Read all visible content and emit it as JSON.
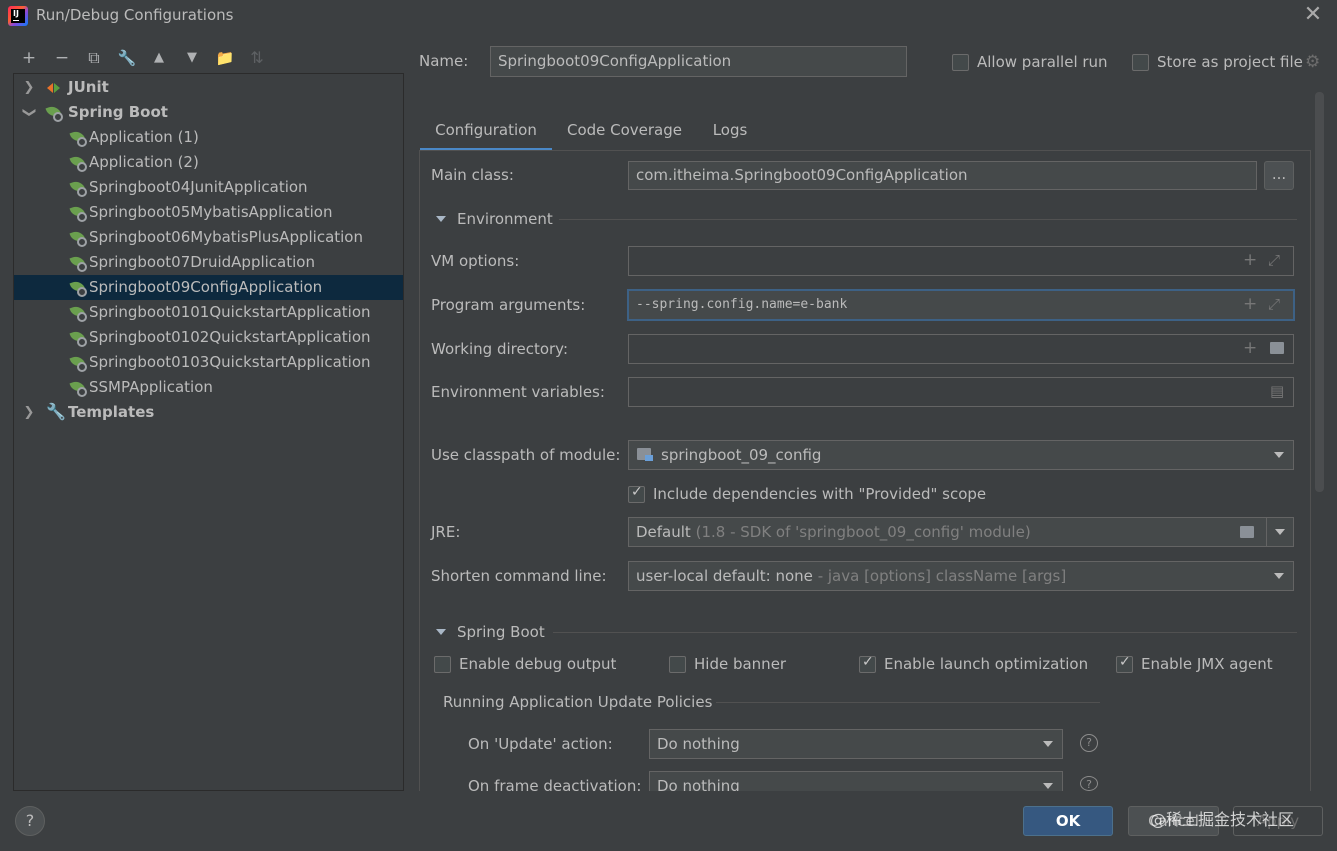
{
  "window": {
    "title": "Run/Debug Configurations"
  },
  "toolbar": {
    "buttons": [
      {
        "icon": "plus-icon",
        "glyph": "+"
      },
      {
        "icon": "minus-icon",
        "glyph": "−"
      },
      {
        "icon": "copy-icon",
        "glyph": "⧉"
      },
      {
        "icon": "wrench-icon",
        "glyph": "🔧"
      },
      {
        "icon": "arrow-up-icon",
        "glyph": "▲"
      },
      {
        "icon": "arrow-down-icon",
        "glyph": "▼"
      },
      {
        "icon": "folder-add-icon",
        "glyph": "📁"
      },
      {
        "icon": "sort-icon",
        "glyph": "⇅"
      }
    ]
  },
  "tree": {
    "junit": "JUnit",
    "spring_boot": "Spring Boot",
    "items": [
      "Application (1)",
      "Application (2)",
      "Springboot04JunitApplication",
      "Springboot05MybatisApplication",
      "Springboot06MybatisPlusApplication",
      "Springboot07DruidApplication",
      "Springboot09ConfigApplication",
      "Springboot0101QuickstartApplication",
      "Springboot0102QuickstartApplication",
      "Springboot0103QuickstartApplication",
      "SSMPApplication"
    ],
    "selected_index": 6,
    "templates": "Templates"
  },
  "header": {
    "name_label": "Name:",
    "name_value": "Springboot09ConfigApplication",
    "allow_parallel": "Allow parallel run",
    "store_project_file": "Store as project file"
  },
  "tabs": [
    "Configuration",
    "Code Coverage",
    "Logs"
  ],
  "config": {
    "main_class_label": "Main class:",
    "main_class_value": "com.itheima.Springboot09ConfigApplication",
    "browse_label": "...",
    "environment_section": "Environment",
    "vm_options_label": "VM options:",
    "vm_options_value": "",
    "program_args_label": "Program arguments:",
    "program_args_value": "--spring.config.name=e-bank",
    "working_dir_label": "Working directory:",
    "working_dir_value": "",
    "env_vars_label": "Environment variables:",
    "env_vars_value": "",
    "classpath_label": "Use classpath of module:",
    "classpath_value": "springboot_09_config",
    "include_deps_label": "Include dependencies with \"Provided\" scope",
    "include_deps_checked": true,
    "jre_label": "JRE:",
    "jre_value": "Default",
    "jre_hint": "(1.8 - SDK of 'springboot_09_config' module)",
    "shorten_label": "Shorten command line:",
    "shorten_value": "user-local default: none",
    "shorten_hint": " - java [options] className [args]",
    "spring_boot_section": "Spring Boot",
    "enable_debug": "Enable debug output",
    "enable_debug_checked": false,
    "hide_banner": "Hide banner",
    "hide_banner_checked": false,
    "launch_opt": "Enable launch optimization",
    "launch_opt_checked": true,
    "jmx_agent": "Enable JMX agent",
    "jmx_agent_checked": true,
    "policies_title": "Running Application Update Policies",
    "on_update_label": "On 'Update' action:",
    "on_update_value": "Do nothing",
    "on_frame_label": "On frame deactivation:",
    "on_frame_value": "Do nothing"
  },
  "footer": {
    "help": "?",
    "ok": "OK",
    "cancel": "Cancel",
    "apply": "Apply",
    "watermark": "@稀土掘金技术社区"
  },
  "colors": {
    "background": "#3c3f41",
    "selection": "#0d293e",
    "accent": "#4a88c7",
    "ok_button": "#365880",
    "spring_green": "#6a9f4e"
  }
}
